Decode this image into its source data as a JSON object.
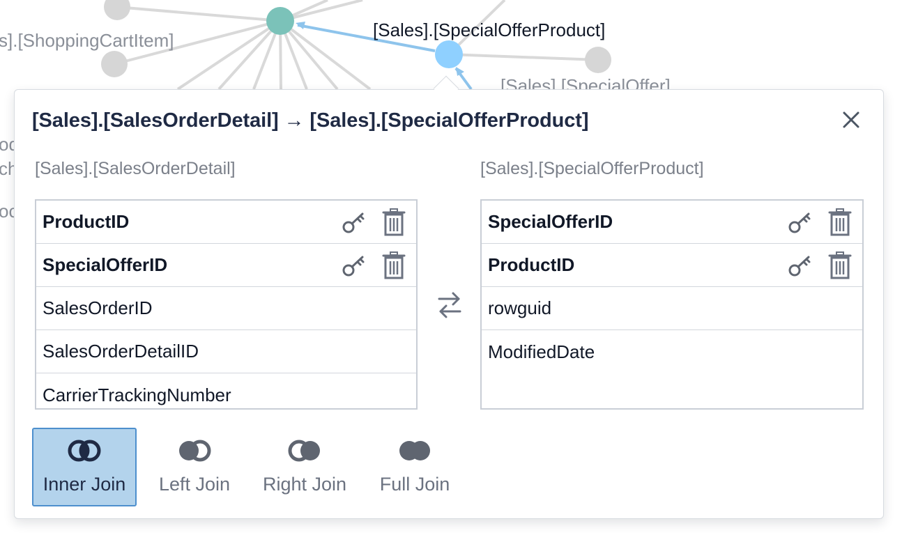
{
  "graph": {
    "labels": {
      "shopping_cart": "s].[ShoppingCartItem]",
      "special_offer_product": "[Sales].[SpecialOfferProduct]",
      "special_offer": "[Sales].[SpecialOffer]",
      "side_text_1": "od",
      "side_text_2": "ch",
      "side_text_3": "oc"
    },
    "colors": {
      "edge": "#d9d9d9",
      "node_gray": "#d6d6d6",
      "node_teal": "#7bc2b9",
      "node_blue": "#8fd0ff",
      "edge_blue": "#8ec4ec"
    }
  },
  "dialog": {
    "title": "[Sales].[SalesOrderDetail] → [Sales].[SpecialOfferProduct]",
    "close_icon": "close-icon",
    "left_table": {
      "title": "[Sales].[SalesOrderDetail]",
      "rows": [
        {
          "label": "ProductID",
          "is_key": true
        },
        {
          "label": "SpecialOfferID",
          "is_key": true
        },
        {
          "label": "SalesOrderID",
          "is_key": false
        },
        {
          "label": "SalesOrderDetailID",
          "is_key": false
        },
        {
          "label": "CarrierTrackingNumber",
          "is_key": false
        }
      ]
    },
    "right_table": {
      "title": "[Sales].[SpecialOfferProduct]",
      "rows": [
        {
          "label": "SpecialOfferID",
          "is_key": true
        },
        {
          "label": "ProductID",
          "is_key": true
        },
        {
          "label": "rowguid",
          "is_key": false
        },
        {
          "label": "ModifiedDate",
          "is_key": false
        }
      ]
    },
    "swap_icon": "swap-arrows-icon",
    "join_options": [
      {
        "label": "Inner Join",
        "icon": "inner-join-icon",
        "selected": true
      },
      {
        "label": "Left Join",
        "icon": "left-join-icon",
        "selected": false
      },
      {
        "label": "Right Join",
        "icon": "right-join-icon",
        "selected": false
      },
      {
        "label": "Full Join",
        "icon": "full-join-icon",
        "selected": false
      }
    ],
    "colors": {
      "selected_bg": "#b3d3ec",
      "selected_border": "#4d8fcd",
      "icon_gray": "#6b7280",
      "title_text": "#1f2a44"
    }
  }
}
